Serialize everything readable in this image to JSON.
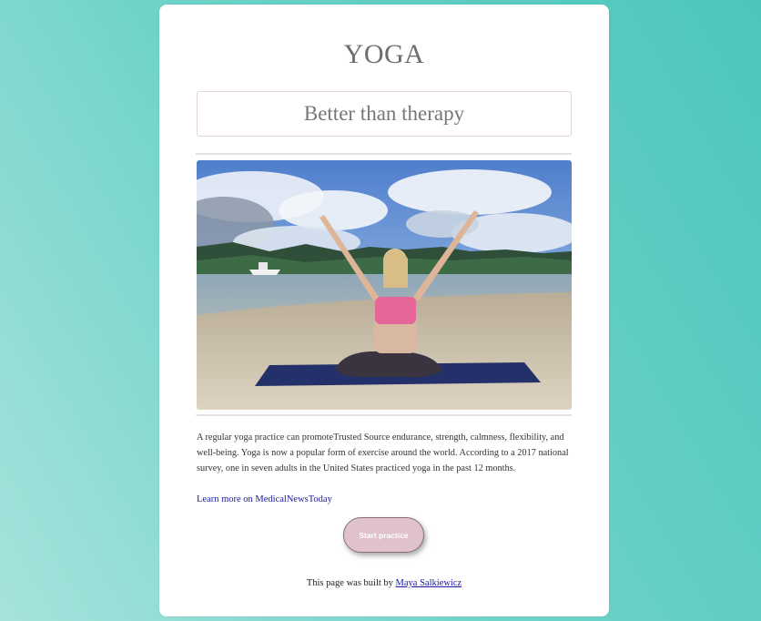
{
  "page": {
    "title": "YOGA",
    "subtitle": "Better than therapy"
  },
  "image": {
    "description_icon": "yoga-photo"
  },
  "content": {
    "paragraph": "A regular yoga practice can promoteTrusted Source endurance, strength, calmness, flexibility, and well-being. Yoga is now a popular form of exercise around the world. According to a 2017 national survey, one in seven adults in the United States practiced yoga in the past 12 months.",
    "learn_more_link": "Learn more on MedicalNewsToday"
  },
  "actions": {
    "start_label": "Start practice"
  },
  "footer": {
    "prefix": "This page was built by ",
    "author": "Maya Salkiewicz"
  },
  "colors": {
    "background_gradient_start": "#a6e3dc",
    "background_gradient_end": "#4cc6bb",
    "card": "#ffffff",
    "button": "#dfc2cd",
    "link": "#1a1aa6"
  }
}
